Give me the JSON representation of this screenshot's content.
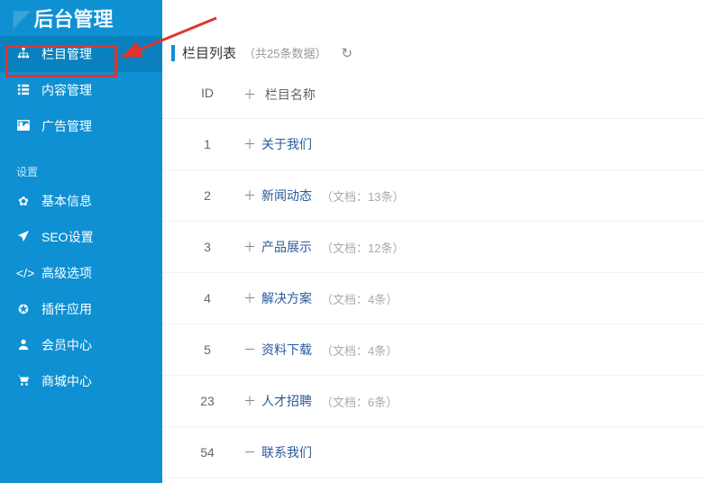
{
  "logo": "后台管理",
  "sidebar": {
    "section1": [
      {
        "label": "栏目管理",
        "icon": "sitemap"
      },
      {
        "label": "内容管理",
        "icon": "list"
      },
      {
        "label": "广告管理",
        "icon": "image"
      }
    ],
    "settingsLabel": "设置",
    "section2": [
      {
        "label": "基本信息",
        "icon": "gear"
      },
      {
        "label": "SEO设置",
        "icon": "plane"
      },
      {
        "label": "高级选项",
        "icon": "code"
      },
      {
        "label": "插件应用",
        "icon": "soccer"
      },
      {
        "label": "会员中心",
        "icon": "user"
      },
      {
        "label": "商城中心",
        "icon": "cart"
      }
    ]
  },
  "header": {
    "title": "栏目列表",
    "count": "（共25条数据）"
  },
  "tableHeader": {
    "id": "ID",
    "plus": "＋",
    "name": "栏目名称"
  },
  "rows": [
    {
      "id": "1",
      "sym": "＋",
      "title": "关于我们",
      "meta": ""
    },
    {
      "id": "2",
      "sym": "＋",
      "title": "新闻动态",
      "meta": "（文档：13条）"
    },
    {
      "id": "3",
      "sym": "＋",
      "title": "产品展示",
      "meta": "（文档：12条）"
    },
    {
      "id": "4",
      "sym": "＋",
      "title": "解决方案",
      "meta": "（文档：4条）"
    },
    {
      "id": "5",
      "sym": "－",
      "title": "资料下载",
      "meta": "（文档：4条）"
    },
    {
      "id": "23",
      "sym": "＋",
      "title": "人才招聘",
      "meta": "（文档：6条）"
    },
    {
      "id": "54",
      "sym": "－",
      "title": "联系我们",
      "meta": ""
    }
  ]
}
